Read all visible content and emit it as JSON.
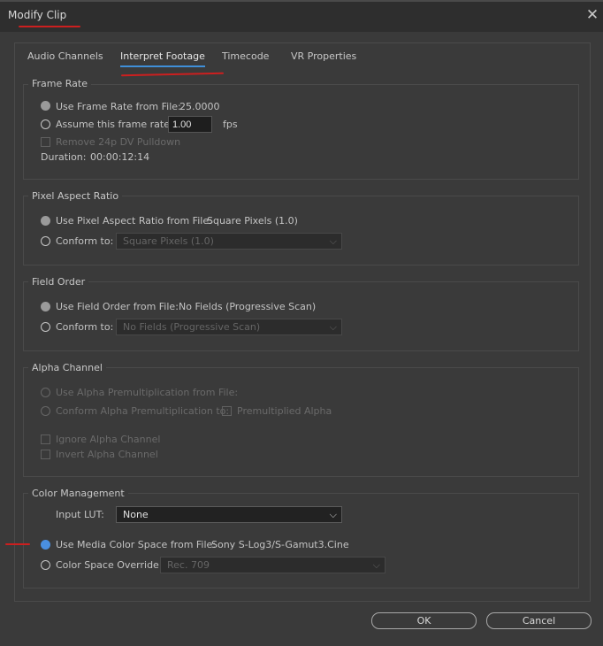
{
  "window": {
    "title": "Modify Clip"
  },
  "tabs": [
    "Audio Channels",
    "Interpret Footage",
    "Timecode",
    "VR Properties"
  ],
  "frame_rate": {
    "title": "Frame Rate",
    "from_file_label": "Use Frame Rate from File:",
    "from_file_value": "25.0000",
    "assume_label": "Assume this frame rate:",
    "assume_value": "1.00",
    "fps": "fps",
    "pulldown_label": "Remove 24p DV Pulldown",
    "duration_label": "Duration:",
    "duration_value": "00:00:12:14"
  },
  "pixel_aspect": {
    "title": "Pixel Aspect Ratio",
    "from_file_label": "Use Pixel Aspect Ratio from File:",
    "from_file_value": "Square Pixels (1.0)",
    "conform_label": "Conform to:",
    "conform_value": "Square Pixels (1.0)"
  },
  "field_order": {
    "title": "Field Order",
    "from_file_label": "Use Field Order from File:",
    "from_file_value": "No Fields (Progressive Scan)",
    "conform_label": "Conform to:",
    "conform_value": "No Fields (Progressive Scan)"
  },
  "alpha": {
    "title": "Alpha Channel",
    "premult_label": "Use Alpha Premultiplication from File:",
    "conform_label": "Conform Alpha Premultiplication to:",
    "premult_check_label": "Premultiplied Alpha",
    "ignore_label": "Ignore Alpha Channel",
    "invert_label": "Invert Alpha Channel"
  },
  "color": {
    "title": "Color Management",
    "lut_label": "Input LUT:",
    "lut_value": "None",
    "media_label": "Use Media Color Space from File:",
    "media_value": "Sony S-Log3/S-Gamut3.Cine",
    "override_label": "Color Space Override:",
    "override_value": "Rec. 709"
  },
  "buttons": {
    "ok": "OK",
    "cancel": "Cancel"
  },
  "colors": {
    "accent": "#4a8fe0",
    "annotation": "#cc1f1f",
    "background": "#3a3a3a"
  },
  "icons": {
    "close": "close-icon",
    "dropdown": "chevron-down-icon"
  }
}
